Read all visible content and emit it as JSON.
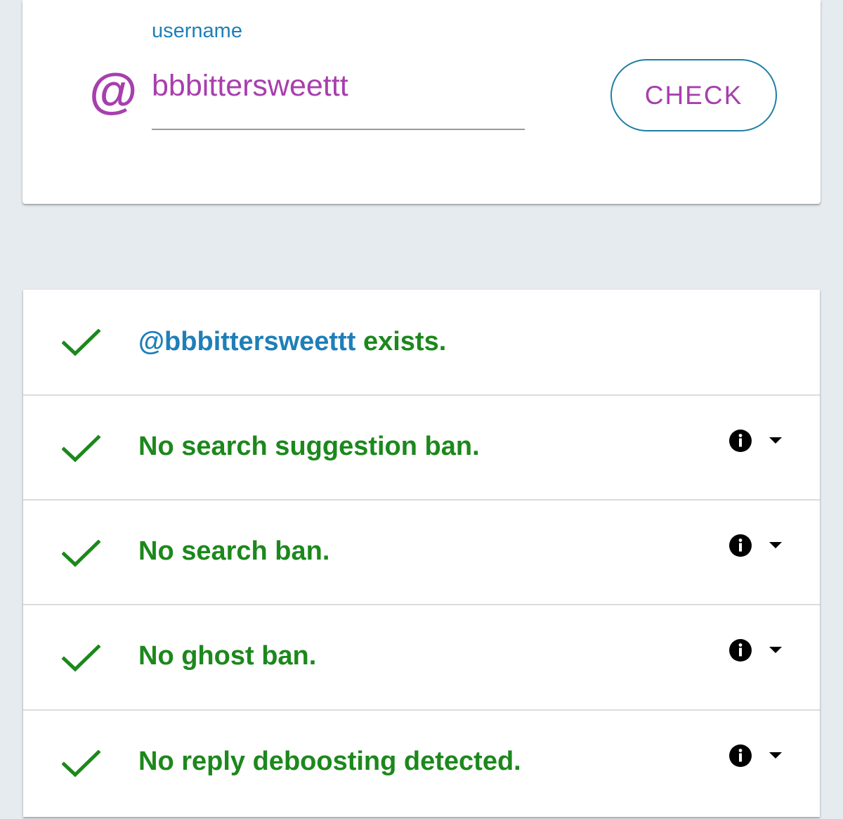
{
  "search": {
    "label": "username",
    "prefix": "@",
    "value": "bbbittersweettt",
    "button_label": "CHECK"
  },
  "results": {
    "exists": {
      "handle": "@bbbittersweettt",
      "suffix": " exists.",
      "status": "pass"
    },
    "items": [
      {
        "label": "No search suggestion ban.",
        "status": "pass"
      },
      {
        "label": "No search ban.",
        "status": "pass"
      },
      {
        "label": "No ghost ban.",
        "status": "pass"
      },
      {
        "label": "No reply deboosting detected.",
        "status": "pass"
      }
    ]
  },
  "colors": {
    "background": "#e6ebef",
    "accent_purple": "#a73fad",
    "link_blue": "#1e7fb8",
    "success_green": "#1c881c",
    "button_border": "#1e7fa6"
  },
  "icons": {
    "status": "check-icon",
    "info": "info-icon",
    "expand": "chevron-down-icon"
  }
}
